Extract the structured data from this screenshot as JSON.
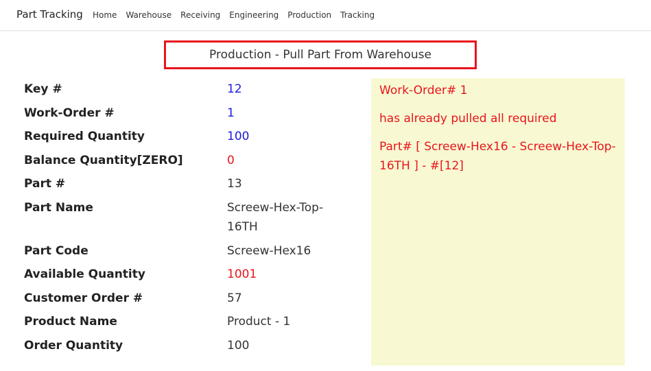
{
  "navbar": {
    "brand": "Part Tracking",
    "links": [
      "Home",
      "Warehouse",
      "Receiving",
      "Engineering",
      "Production",
      "Tracking"
    ]
  },
  "page": {
    "title": "Production - Pull Part From Warehouse"
  },
  "details": {
    "key": {
      "label": "Key #",
      "value": "12"
    },
    "work_order": {
      "label": "Work-Order #",
      "value": "1"
    },
    "required_quantity": {
      "label": "Required Quantity",
      "value": "100"
    },
    "balance_quantity": {
      "label": "Balance Quantity[ZERO]",
      "value": "0"
    },
    "part_number": {
      "label": "Part #",
      "value": "13"
    },
    "part_name": {
      "label": "Part Name",
      "value": "Screew-Hex-Top-16TH"
    },
    "part_code": {
      "label": "Part Code",
      "value": "Screew-Hex16"
    },
    "available_quantity": {
      "label": "Available Quantity",
      "value": "1001"
    },
    "customer_order": {
      "label": "Customer Order #",
      "value": "57"
    },
    "product_name": {
      "label": "Product Name",
      "value": "Product - 1"
    },
    "order_quantity": {
      "label": "Order Quantity",
      "value": "100"
    }
  },
  "notice": {
    "line1": "Work-Order# 1",
    "line2": "has already pulled all required",
    "line3": "Part# [ Screew-Hex16 - Screew-Hex-Top-16TH ] - #[12]"
  },
  "colors": {
    "accent_red": "#e8141c",
    "value_blue": "#1a1adb",
    "notice_bg": "#f8f9d2"
  }
}
